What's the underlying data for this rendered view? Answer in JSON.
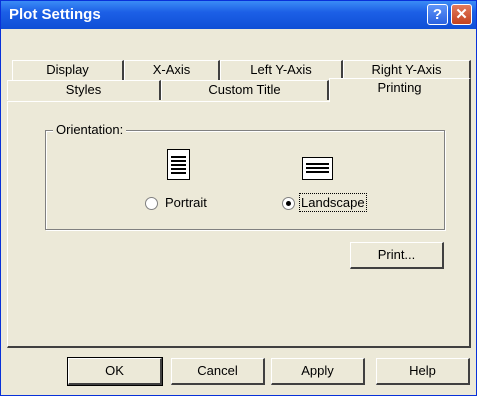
{
  "window": {
    "title": "Plot Settings",
    "help_glyph": "?",
    "close_glyph": "✕"
  },
  "tabs": {
    "row1": [
      {
        "label": "Display"
      },
      {
        "label": "X-Axis"
      },
      {
        "label": "Left Y-Axis"
      },
      {
        "label": "Right Y-Axis"
      }
    ],
    "row2": [
      {
        "label": "Styles"
      },
      {
        "label": "Custom Title"
      },
      {
        "label": "Printing",
        "active": true
      }
    ]
  },
  "orientation": {
    "group_label": "Orientation:",
    "options": [
      {
        "label": "Portrait",
        "checked": false,
        "icon": "portrait-document-icon"
      },
      {
        "label": "Landscape",
        "checked": true,
        "icon": "landscape-document-icon"
      }
    ]
  },
  "print_button": "Print...",
  "buttons": {
    "ok": "OK",
    "cancel": "Cancel",
    "apply": "Apply",
    "help": "Help"
  }
}
